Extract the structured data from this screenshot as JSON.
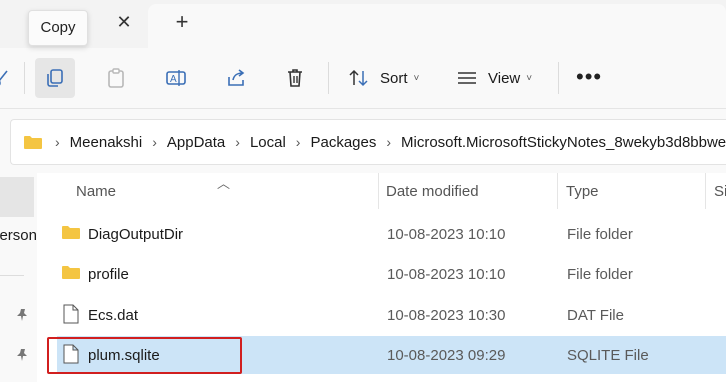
{
  "tooltip": {
    "text": "Copy"
  },
  "tabs": {
    "close_icon": "close-icon",
    "new_tab_icon": "plus-icon"
  },
  "toolbar": {
    "sort_label": "Sort",
    "view_label": "View",
    "more_label": "•••",
    "caret": "˅"
  },
  "address": {
    "separator": "›",
    "segments": [
      "Meenakshi",
      "AppData",
      "Local",
      "Packages",
      "Microsoft.MicrosoftStickyNotes_8wekyb3d8bbwe"
    ]
  },
  "nav": {
    "partial_label": "erson"
  },
  "columns": {
    "name": "Name",
    "date_modified": "Date modified",
    "type": "Type",
    "size": "Si"
  },
  "files": [
    {
      "name": "DiagOutputDir",
      "date": "10-08-2023 10:10",
      "type": "File folder",
      "icon": "folder-icon",
      "selected": false
    },
    {
      "name": "profile",
      "date": "10-08-2023 10:10",
      "type": "File folder",
      "icon": "folder-icon",
      "selected": false
    },
    {
      "name": "Ecs.dat",
      "date": "10-08-2023 10:30",
      "type": "DAT File",
      "icon": "file-icon",
      "selected": false
    },
    {
      "name": "plum.sqlite",
      "date": "10-08-2023 09:29",
      "type": "SQLITE File",
      "icon": "file-icon",
      "selected": true
    }
  ],
  "colors": {
    "selection": "#cce4f7",
    "highlight_border": "#d11f1f",
    "folder": "#f4c542"
  }
}
